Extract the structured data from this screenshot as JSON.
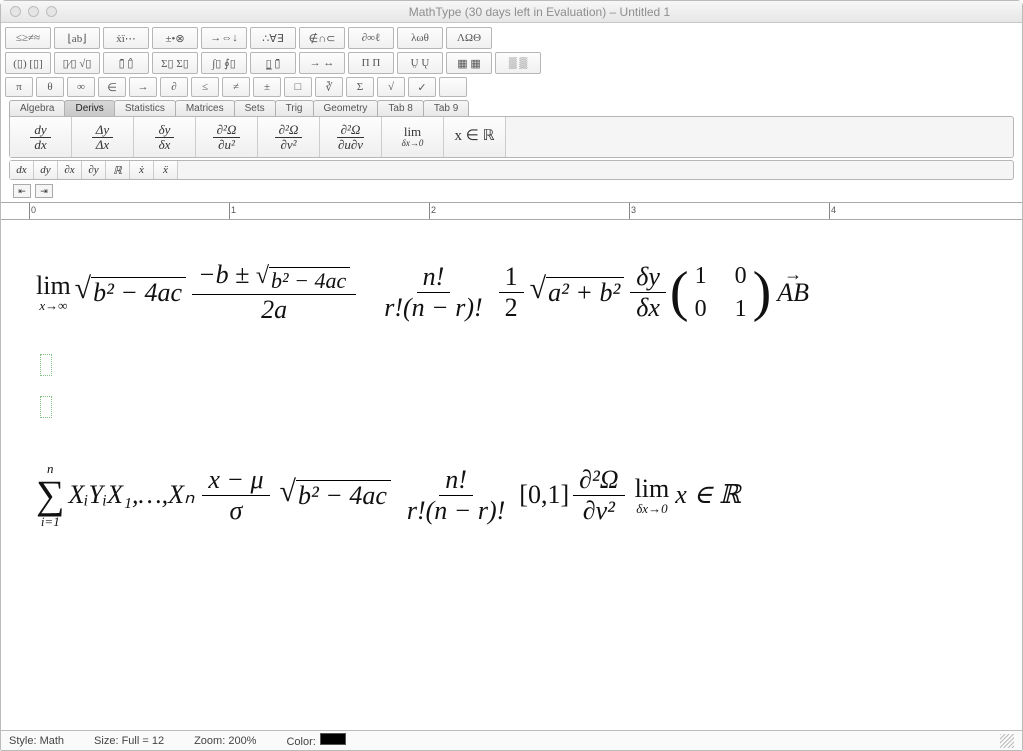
{
  "window": {
    "title": "MathType (30 days left in Evaluation) – Untitled 1"
  },
  "palettes": {
    "row1": [
      "≤≥≠≈",
      "⌊ab⌋",
      "ẋï⋯",
      "±•⊗",
      "→⇔↓",
      "∴∀∃",
      "∉∩⊂",
      "∂∞ℓ",
      "λωθ",
      "ΛΩΘ"
    ],
    "row2": [
      "(▯) [▯]",
      "▯⁄▯ √▯",
      "▯̄ ▯̂",
      "Σ▯ Σ▯",
      "∫▯ ∮▯",
      "▯̲ ▯̄",
      "→ ↔",
      "Π Π",
      "Ṳ Ų",
      "▦ ▦",
      "▒ ▒"
    ],
    "row3": [
      "π",
      "θ",
      "∞",
      "∈",
      "→",
      "∂",
      "≤",
      "≠",
      "±",
      "□",
      "∛",
      "Σ",
      "√",
      "✓",
      ""
    ]
  },
  "tabs": [
    "Algebra",
    "Derivs",
    "Statistics",
    "Matrices",
    "Sets",
    "Trig",
    "Geometry",
    "Tab 8",
    "Tab 9"
  ],
  "active_tab": "Derivs",
  "derivs": [
    {
      "num": "dy",
      "den": "dx"
    },
    {
      "num": "Δy",
      "den": "Δx"
    },
    {
      "num": "δy",
      "den": "δx"
    },
    {
      "num": "∂²Ω",
      "den": "∂u²"
    },
    {
      "num": "∂²Ω",
      "den": "∂v²"
    },
    {
      "num": "∂²Ω",
      "den": "∂u∂v"
    },
    {
      "num": "lim",
      "den": "δx→0"
    },
    {
      "num": "x ∈ ℝ",
      "den": ""
    }
  ],
  "smallbar": [
    "dx",
    "dy",
    "∂x",
    "∂y",
    "ℝ",
    "ẋ",
    "ẍ"
  ],
  "ruler": {
    "marks": [
      "0",
      "1",
      "2",
      "3",
      "4"
    ]
  },
  "math": {
    "row1": {
      "lim_label": "lim",
      "lim_sub": "x→∞",
      "sqrt1": "b² − 4ac",
      "quad_num": "−b ± √(b² − 4ac)",
      "quad_num_inner": "b² − 4ac",
      "quad_num_pre": "−b ±",
      "quad_den": "2a",
      "binom_num": "n!",
      "binom_den": "r!(n − r)!",
      "half_num": "1",
      "half_den": "2",
      "pyth": "a² + b²",
      "dydx_num": "δy",
      "dydx_den": "δx",
      "m11": "1",
      "m12": "0",
      "m21": "0",
      "m22": "1",
      "vec": "AB"
    },
    "row2": {
      "sum_top": "n",
      "sum_bot": "i=1",
      "terms": "XᵢYᵢX₁,…,Xₙ",
      "z_num": "x − μ",
      "z_den": "σ",
      "disc": "b² − 4ac",
      "binom_num": "n!",
      "binom_den": "r!(n − r)!",
      "interval": "[0,1]",
      "p2_num": "∂²Ω",
      "p2_den": "∂v²",
      "lim_label": "lim",
      "lim_sub": "δx→0",
      "tail": "x ∈ ℝ"
    }
  },
  "status": {
    "style_label": "Style:",
    "style_value": "Math",
    "size_label": "Size:",
    "size_value": "Full = 12",
    "zoom_label": "Zoom:",
    "zoom_value": "200%",
    "color_label": "Color:"
  }
}
